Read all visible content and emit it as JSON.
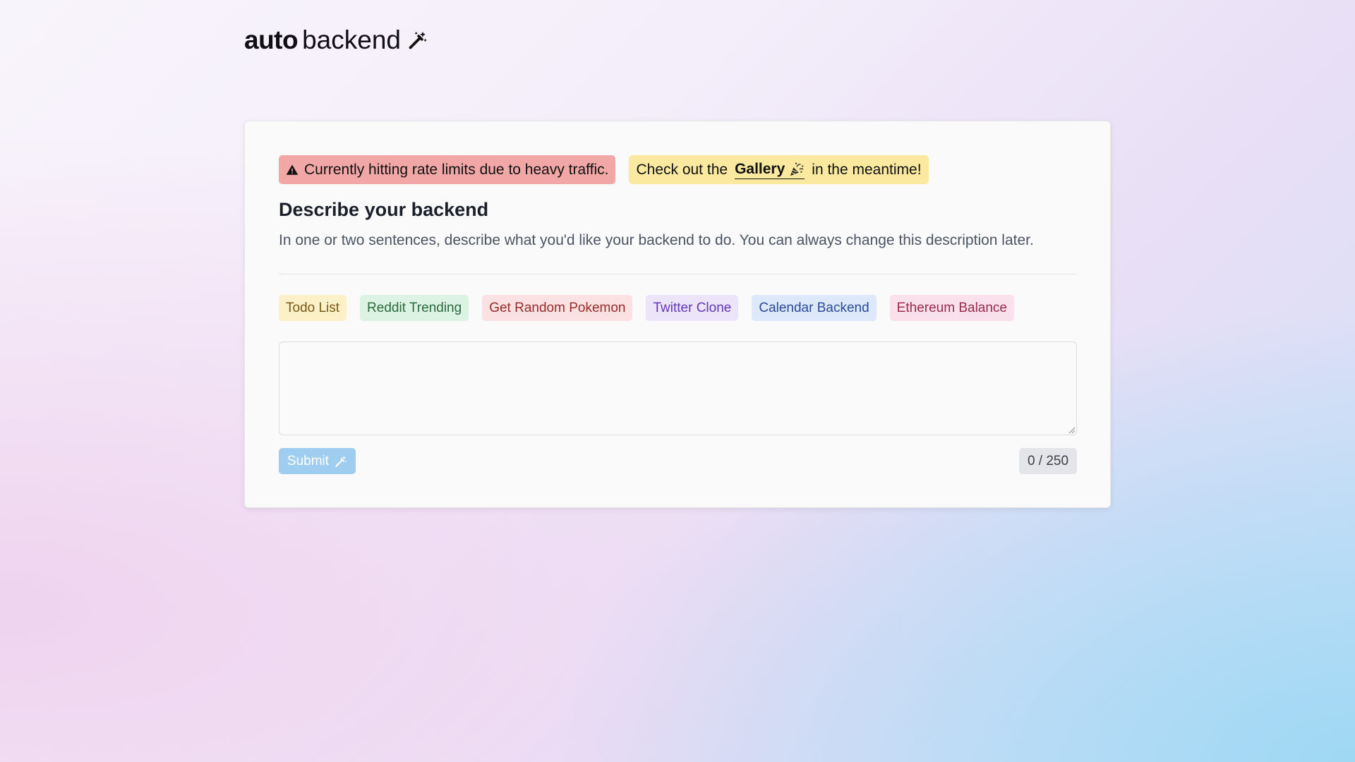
{
  "logo": {
    "bold": "auto",
    "regular": "backend",
    "icon": "magic-wand-icon"
  },
  "alerts": {
    "rate_limit": {
      "icon": "warning-triangle-icon",
      "text": "Currently hitting rate limits due to heavy traffic.",
      "color": "#f2a7a7"
    },
    "gallery": {
      "prefix": "Check out the",
      "link": "Gallery",
      "link_icon": "party-popper-icon",
      "suffix": "in the meantime!",
      "color": "#fbe9a0"
    }
  },
  "form": {
    "title": "Describe your backend",
    "subtitle": "In one or two sentences, describe what you'd like your backend to do. You can always change this description later.",
    "examples": [
      {
        "label": "Todo List",
        "bg": "#fbf0c8",
        "fg": "#7a5a12"
      },
      {
        "label": "Reddit Trending",
        "bg": "#dcf3e3",
        "fg": "#2b6a3d"
      },
      {
        "label": "Get Random Pokemon",
        "bg": "#fbe1e1",
        "fg": "#9a2c2c"
      },
      {
        "label": "Twitter Clone",
        "bg": "#ece5fa",
        "fg": "#6535b8"
      },
      {
        "label": "Calendar Backend",
        "bg": "#dde8fb",
        "fg": "#2a4a9a"
      },
      {
        "label": "Ethereum Balance",
        "bg": "#f9e0ea",
        "fg": "#9a2a4c"
      }
    ],
    "description_value": "",
    "description_placeholder": "",
    "submit_label": "Submit",
    "submit_icon": "magic-wand-icon",
    "char_count": "0 / 250"
  }
}
